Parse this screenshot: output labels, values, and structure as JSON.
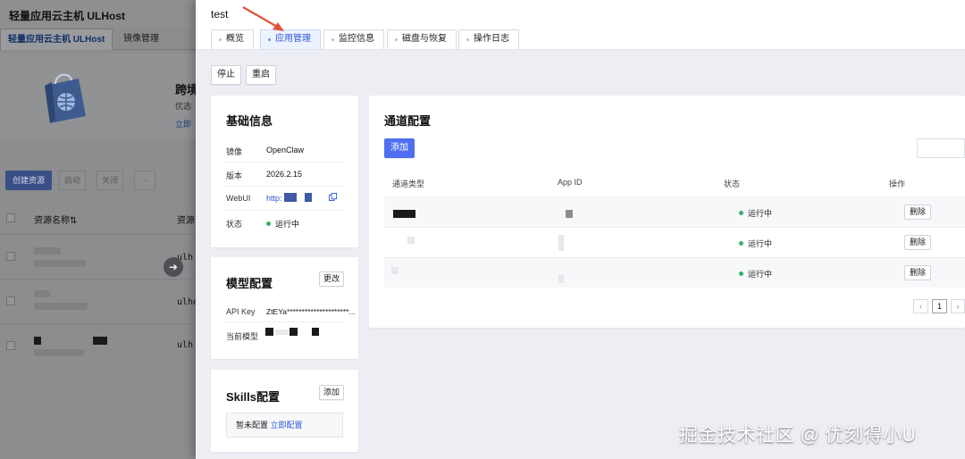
{
  "background": {
    "app_title": "轻量应用云主机 ULHost",
    "tabs": [
      {
        "label": "轻量应用云主机 ULHost",
        "active": true
      },
      {
        "label": "镜像管理",
        "active": false
      }
    ],
    "banner": {
      "title": "跨境",
      "subtitle": "优选",
      "link": "立即"
    },
    "toolbar": {
      "create_label": "创建资源",
      "btn2": "启动",
      "btn3": "关闭",
      "more": "···"
    },
    "table": {
      "col_name": "资源名称⇅",
      "col_resource": "资源",
      "rows": [
        {
          "host": "ulh"
        },
        {
          "host": "ulho"
        },
        {
          "host": "ulh"
        }
      ]
    }
  },
  "drawer": {
    "title": "test",
    "tabs": [
      {
        "label": "概览",
        "active": false
      },
      {
        "label": "应用管理",
        "active": true
      },
      {
        "label": "监控信息",
        "active": false
      },
      {
        "label": "磁盘与恢复",
        "active": false
      },
      {
        "label": "操作日志",
        "active": false
      }
    ],
    "actions": {
      "stop": "停止",
      "restart": "重启"
    },
    "basic_info": {
      "title": "基础信息",
      "image_label": "镜像",
      "image_value": "OpenClaw",
      "version_label": "版本",
      "version_value": "2026.2.15",
      "webui_label": "WebUI",
      "webui_value": "http:",
      "status_label": "状态",
      "status_value": "运行中"
    },
    "model_config": {
      "title": "模型配置",
      "edit_label": "更改",
      "api_key_label": "API Key",
      "api_key_value": "ZtEYa*********************...",
      "current_model_label": "当前模型"
    },
    "skills_config": {
      "title": "Skills配置",
      "add_label": "添加",
      "empty_text": "暂未配置",
      "configure_link": "立即配置"
    },
    "channels": {
      "title": "通道配置",
      "add_label": "添加",
      "columns": [
        "通道类型",
        "App ID",
        "状态",
        "操作"
      ],
      "rows": [
        {
          "status": "运行中",
          "action": "删除"
        },
        {
          "status": "运行中",
          "action": "删除"
        },
        {
          "status": "运行中",
          "action": "删除"
        }
      ],
      "pagination": {
        "prev": "‹",
        "current": "1",
        "next": "›"
      }
    }
  },
  "watermark": "掘金技术社区 @ 优刻得小U",
  "colors": {
    "accent": "#4f6ef0",
    "status_running": "#34b36a",
    "annotation_arrow": "#e0533a"
  }
}
